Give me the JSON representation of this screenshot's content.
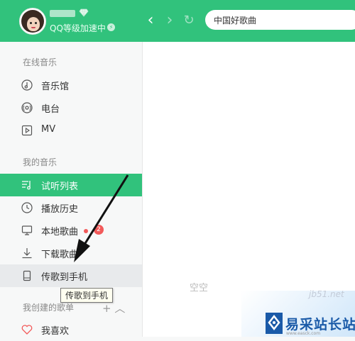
{
  "header": {
    "vip_text": "QQ等级加速中",
    "search_value": "中国好歌曲",
    "colors": {
      "brand": "#31c27c"
    }
  },
  "sidebar": {
    "online_title": "在线音乐",
    "online_items": [
      {
        "label": "音乐馆",
        "icon": "music-hall-icon"
      },
      {
        "label": "电台",
        "icon": "radio-icon"
      },
      {
        "label": "MV",
        "icon": "mv-icon"
      }
    ],
    "my_title": "我的音乐",
    "my_items": [
      {
        "label": "试听列表",
        "icon": "playlist-icon"
      },
      {
        "label": "播放历史",
        "icon": "history-icon"
      },
      {
        "label": "本地歌曲",
        "icon": "computer-icon",
        "badge": "2"
      },
      {
        "label": "下载歌曲",
        "icon": "download-icon"
      },
      {
        "label": "传歌到手机",
        "icon": "phone-icon"
      }
    ],
    "created_title": "我创建的歌单",
    "created_actions": "+ ︿",
    "favorites_label": "我喜欢"
  },
  "tooltip": "传歌到手机",
  "main": {
    "empty_text": "空空",
    "watermark_site": "jb51.net",
    "logo_text": "易采站长站",
    "logo_url": "www.easck.com"
  }
}
